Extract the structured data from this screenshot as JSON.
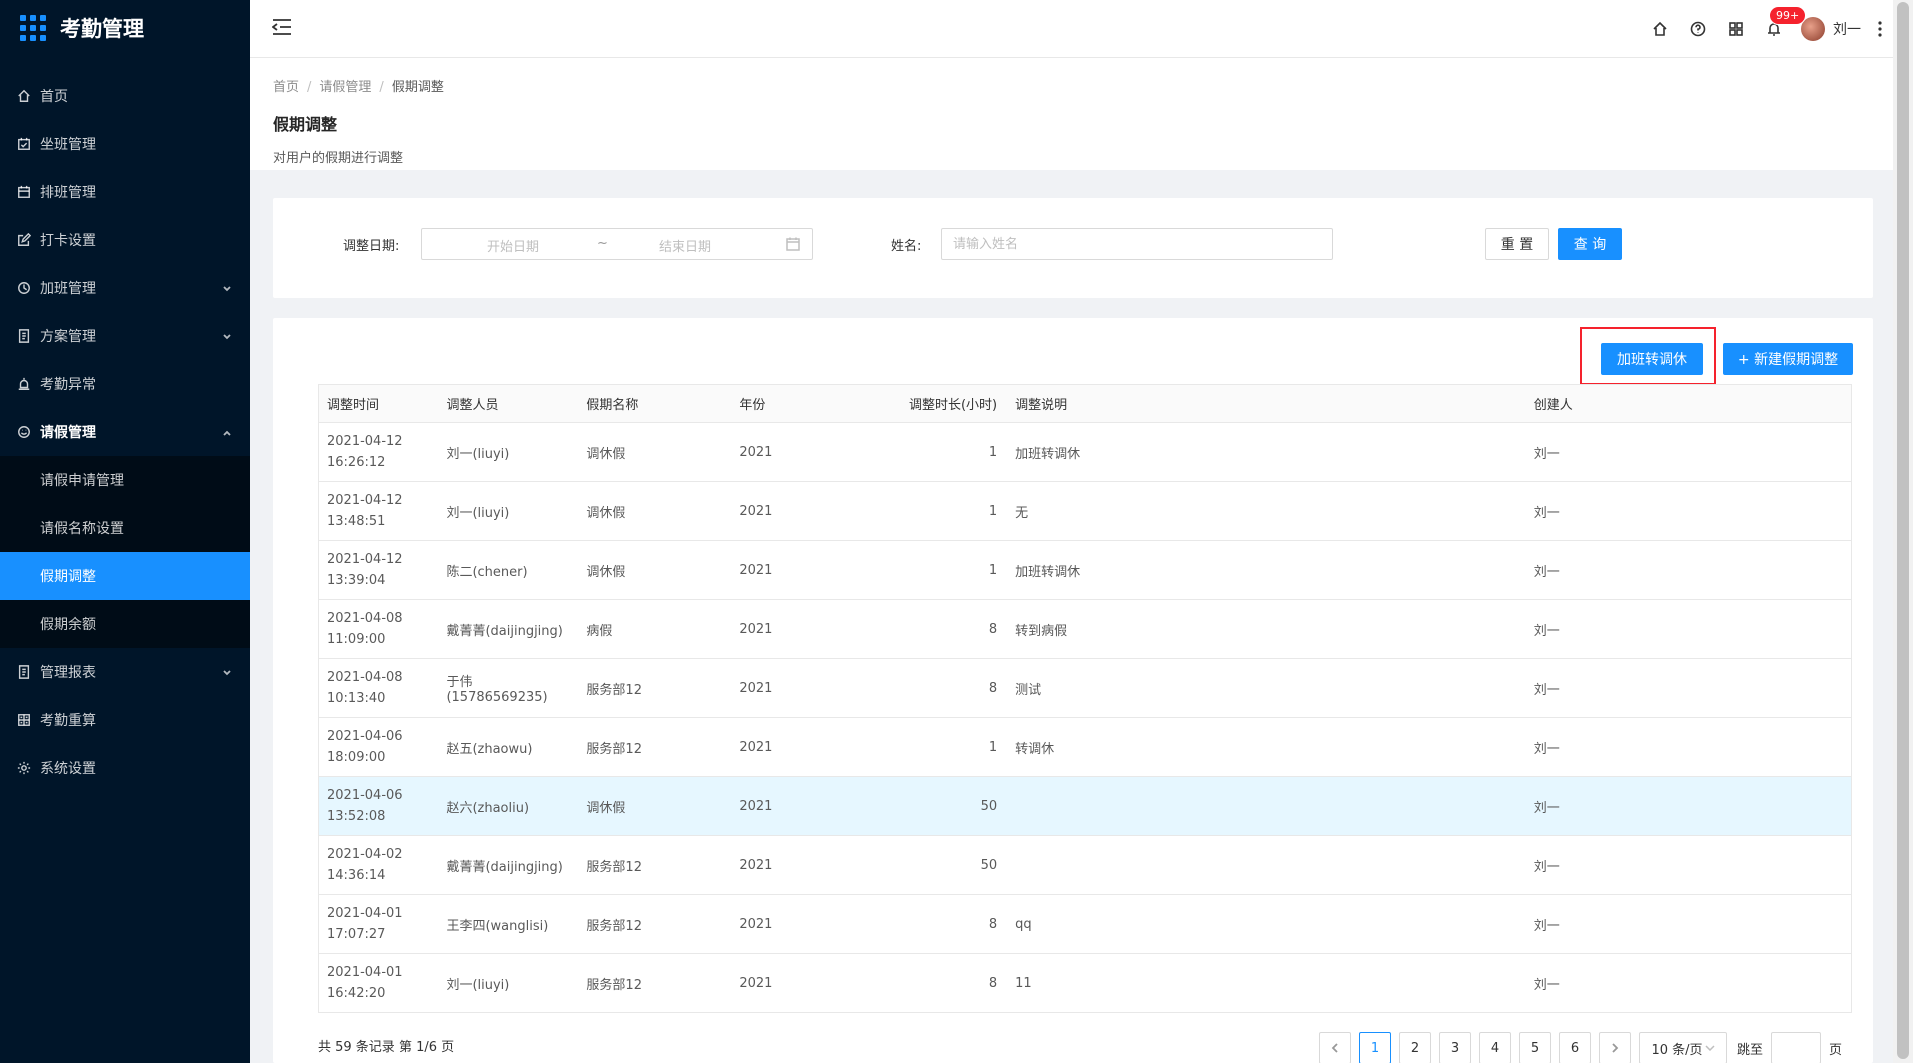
{
  "app": {
    "title": "考勤管理"
  },
  "sidebar": {
    "items": [
      {
        "label": "首页",
        "icon": "home-icon"
      },
      {
        "label": "坐班管理",
        "icon": "calendar-check-icon"
      },
      {
        "label": "排班管理",
        "icon": "schedule-icon"
      },
      {
        "label": "打卡设置",
        "icon": "edit-icon"
      },
      {
        "label": "加班管理",
        "icon": "clock-icon",
        "expandable": true
      },
      {
        "label": "方案管理",
        "icon": "document-icon",
        "expandable": true
      },
      {
        "label": "考勤异常",
        "icon": "alarm-icon"
      },
      {
        "label": "请假管理",
        "icon": "clock-icon",
        "expandable": true,
        "open": true
      },
      {
        "label": "管理报表",
        "icon": "report-icon",
        "expandable": true
      },
      {
        "label": "考勤重算",
        "icon": "calculator-icon"
      },
      {
        "label": "系统设置",
        "icon": "gear-icon"
      }
    ],
    "leave_submenu": [
      {
        "label": "请假申请管理"
      },
      {
        "label": "请假名称设置"
      },
      {
        "label": "假期调整",
        "active": true
      },
      {
        "label": "假期余额"
      }
    ]
  },
  "header": {
    "notification_count": "99+",
    "user_name": "刘一"
  },
  "breadcrumb": [
    "首页",
    "请假管理",
    "假期调整"
  ],
  "page": {
    "title": "假期调整",
    "description": "对用户的假期进行调整"
  },
  "search": {
    "date_label": "调整日期:",
    "start_placeholder": "开始日期",
    "range_sep": "~",
    "end_placeholder": "结束日期",
    "name_label": "姓名:",
    "name_placeholder": "请输入姓名",
    "reset_label": "重 置",
    "query_label": "查 询"
  },
  "toolbar": {
    "convert_label": "加班转调休",
    "new_label": "+ 新建假期调整"
  },
  "table": {
    "columns": [
      "调整时间",
      "调整人员",
      "假期名称",
      "年份",
      "调整时长(小时)",
      "调整说明",
      "创建人"
    ],
    "rows": [
      {
        "date": "2021-04-12",
        "time": "16:26:12",
        "person": "刘一(liuyi)",
        "leave": "调休假",
        "year": "2021",
        "hours": "1",
        "note": "加班转调休",
        "creator": "刘一"
      },
      {
        "date": "2021-04-12",
        "time": "13:48:51",
        "person": "刘一(liuyi)",
        "leave": "调休假",
        "year": "2021",
        "hours": "1",
        "note": "无",
        "creator": "刘一"
      },
      {
        "date": "2021-04-12",
        "time": "13:39:04",
        "person": "陈二(chener)",
        "leave": "调休假",
        "year": "2021",
        "hours": "1",
        "note": "加班转调休",
        "creator": "刘一"
      },
      {
        "date": "2021-04-08",
        "time": "11:09:00",
        "person": "戴菁菁(daijingjing)",
        "leave": "病假",
        "year": "2021",
        "hours": "8",
        "note": "转到病假",
        "creator": "刘一"
      },
      {
        "date": "2021-04-08",
        "time": "10:13:40",
        "person": "于伟(15786569235)",
        "leave": "服务部12",
        "year": "2021",
        "hours": "8",
        "note": "测试",
        "creator": "刘一"
      },
      {
        "date": "2021-04-06",
        "time": "18:09:00",
        "person": "赵五(zhaowu)",
        "leave": "服务部12",
        "year": "2021",
        "hours": "1",
        "note": "转调休",
        "creator": "刘一"
      },
      {
        "date": "2021-04-06",
        "time": "13:52:08",
        "person": "赵六(zhaoliu)",
        "leave": "调休假",
        "year": "2021",
        "hours": "50",
        "note": "",
        "creator": "刘一"
      },
      {
        "date": "2021-04-02",
        "time": "14:36:14",
        "person": "戴菁菁(daijingjing)",
        "leave": "服务部12",
        "year": "2021",
        "hours": "50",
        "note": "",
        "creator": "刘一"
      },
      {
        "date": "2021-04-01",
        "time": "17:07:27",
        "person": "王李四(wanglisi)",
        "leave": "服务部12",
        "year": "2021",
        "hours": "8",
        "note": "qq",
        "creator": "刘一"
      },
      {
        "date": "2021-04-01",
        "time": "16:42:20",
        "person": "刘一(liuyi)",
        "leave": "服务部12",
        "year": "2021",
        "hours": "8",
        "note": "11",
        "creator": "刘一"
      }
    ]
  },
  "pagination": {
    "summary": "共 59 条记录 第 1/6 页",
    "pages": [
      "1",
      "2",
      "3",
      "4",
      "5",
      "6"
    ],
    "current": "1",
    "page_size": "10 条/页",
    "jump_label": "跳至",
    "page_suffix": "页"
  },
  "colors": {
    "primary": "#1890ff",
    "sidebar_bg": "#001529",
    "highlight_border": "#f5222d"
  }
}
